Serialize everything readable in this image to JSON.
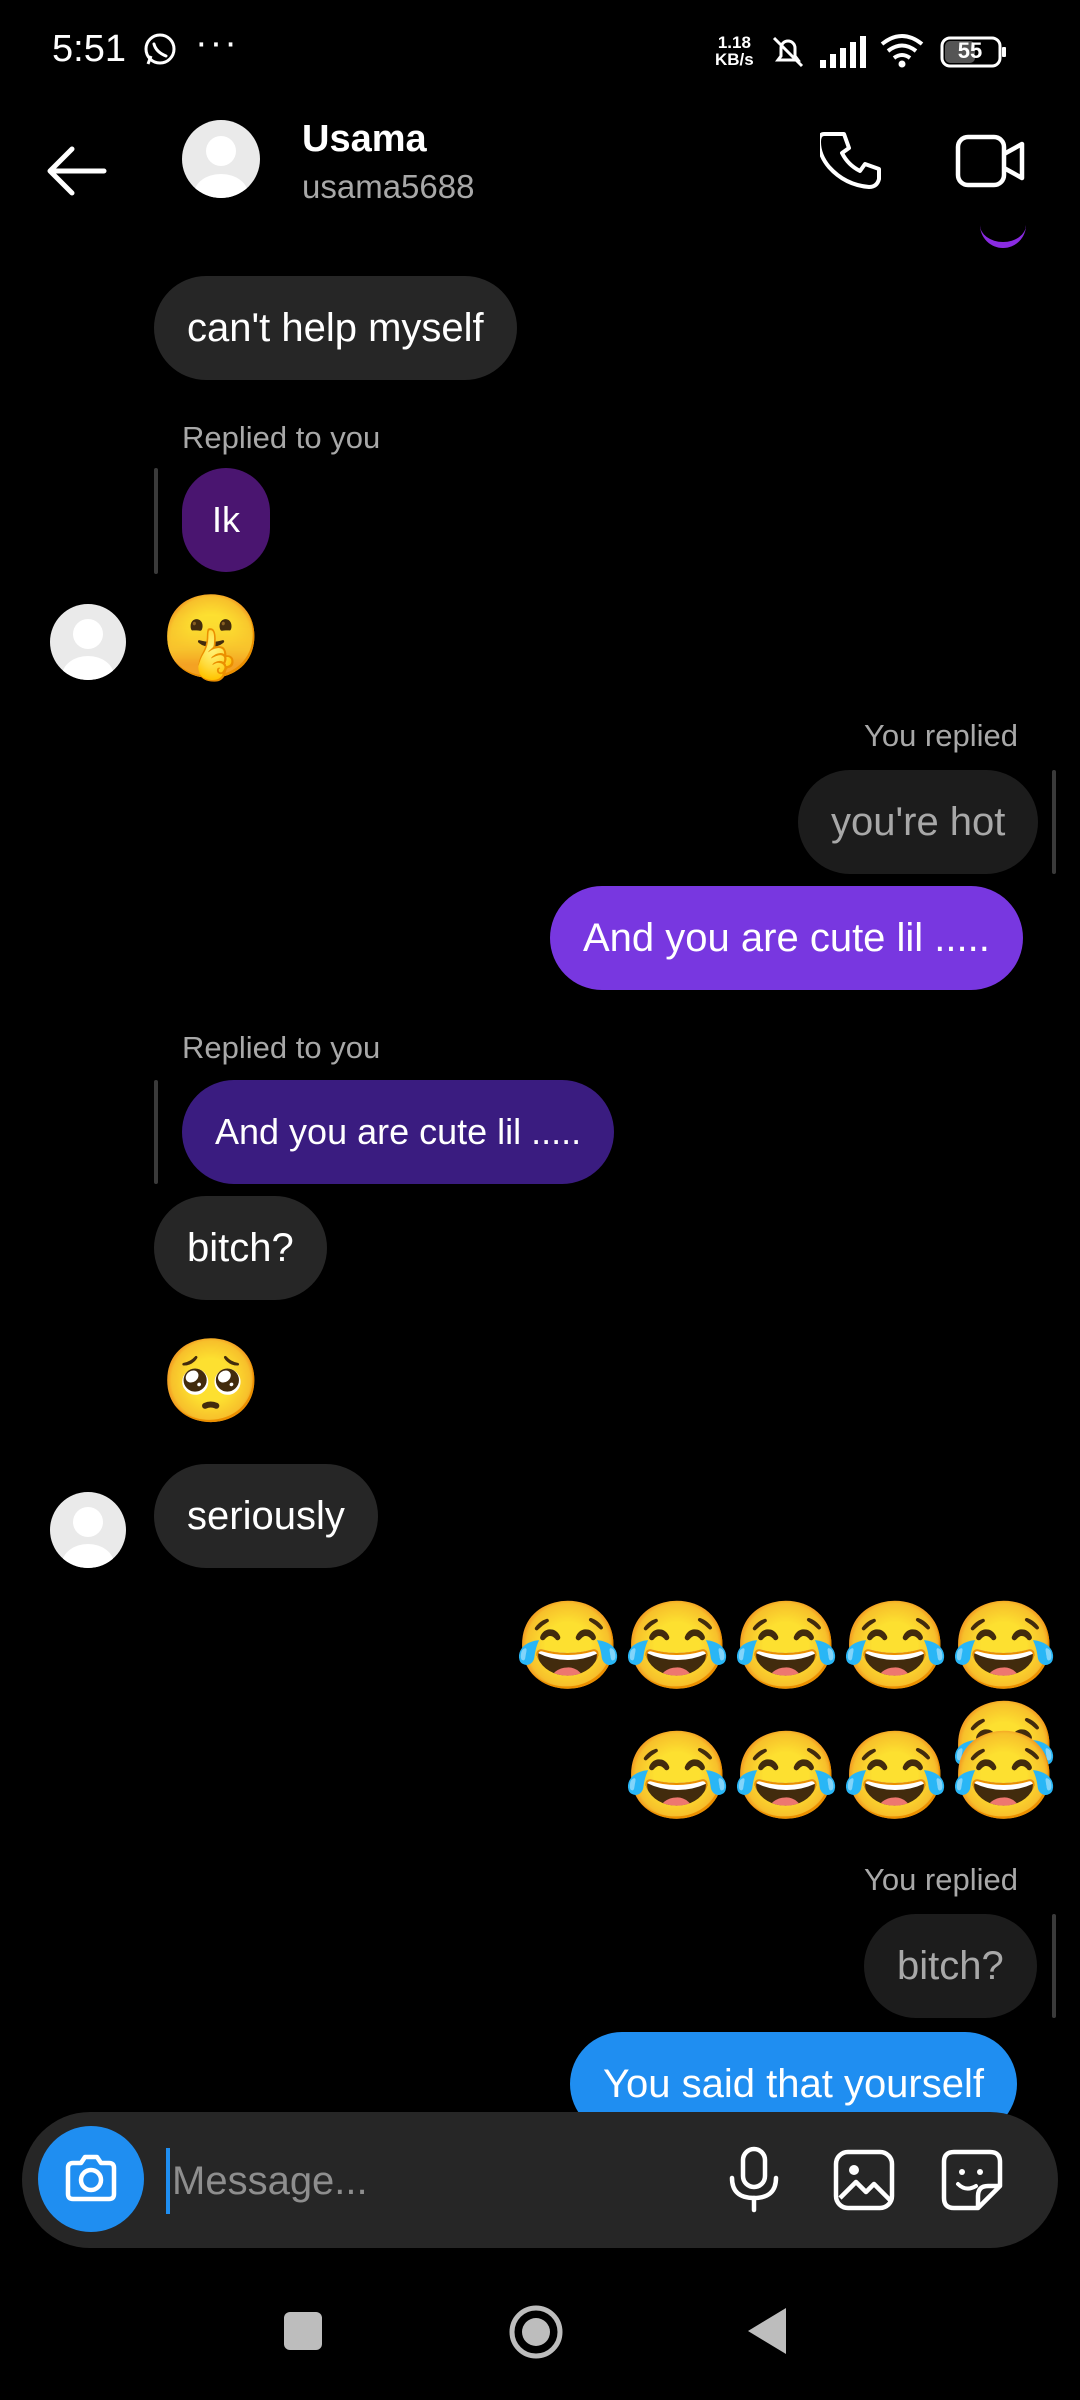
{
  "status_bar": {
    "time": "5:51",
    "more": "···",
    "speed_value": "1.18",
    "speed_unit": "KB/s",
    "battery": "55"
  },
  "header": {
    "name": "Usama",
    "username": "usama5688"
  },
  "messages": {
    "m1": "can't help myself",
    "m2_meta": "Replied to you",
    "m2_quote": "Ik",
    "m3_emoji": "🤫",
    "m4_meta": "You replied",
    "m4_quote": "you're hot",
    "m5": "And you are cute lil .....",
    "m6_meta": "Replied to you",
    "m6_quote": "And you are cute lil .....",
    "m7": "bitch?",
    "m8_emoji": "🥺",
    "m9": "seriously",
    "m10_emoji": "😂😂😂😂😂😂",
    "m11_emoji": "😂😂😂😂",
    "m12_meta": "You replied",
    "m12_quote": "bitch?",
    "m13": "You said that yourself"
  },
  "composer": {
    "placeholder": "Message..."
  },
  "colors": {
    "outgoing": "#7837e0",
    "outgoing_blue": "#1f8ef1",
    "incoming": "#262626",
    "quote_purple": "#4a1570",
    "quote_indigo": "#3a1c80"
  },
  "icons": [
    "back-arrow-icon",
    "phone-icon",
    "video-camera-icon",
    "camera-icon",
    "microphone-icon",
    "gallery-icon",
    "sticker-icon"
  ]
}
